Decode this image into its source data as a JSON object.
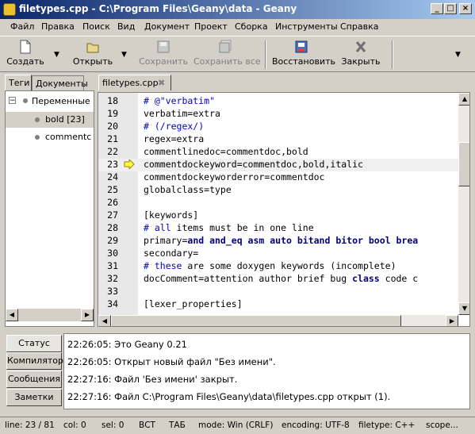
{
  "window": {
    "title": "filetypes.cpp - C:\\Program Files\\Geany\\data - Geany",
    "controls": [
      "_",
      "□",
      "×"
    ]
  },
  "menu": [
    "Файл",
    "Правка",
    "Поиск",
    "Вид",
    "Документ",
    "Проект",
    "Сборка",
    "Инструменты",
    "Справка"
  ],
  "toolbar": {
    "new": "Создать",
    "open": "Открыть",
    "save": "Сохранить",
    "save_all": "Сохранить все",
    "revert": "Восстановить",
    "close": "Закрыть"
  },
  "sidebar": {
    "tabs": [
      "Теги",
      "Документы"
    ],
    "tree": [
      {
        "label": "Переменные",
        "expander": "−"
      },
      {
        "label": "bold [23]"
      },
      {
        "label": "commentc"
      }
    ]
  },
  "editor": {
    "tab_label": "filetypes.cpp",
    "lines": [
      {
        "n": "18",
        "segments": [
          {
            "t": "# @\"verbatim\"",
            "c": "cm"
          }
        ]
      },
      {
        "n": "19",
        "segments": [
          {
            "t": "verbatim=extra",
            "c": ""
          }
        ]
      },
      {
        "n": "20",
        "segments": [
          {
            "t": "# (/regex/)",
            "c": "cm"
          }
        ]
      },
      {
        "n": "21",
        "segments": [
          {
            "t": "regex=extra",
            "c": ""
          }
        ]
      },
      {
        "n": "22",
        "segments": [
          {
            "t": "commentlinedoc=commentdoc,bold",
            "c": ""
          }
        ]
      },
      {
        "n": "23",
        "segments": [
          {
            "t": "commentdockeyword=commentdoc,bold,italic",
            "c": ""
          }
        ],
        "current": true
      },
      {
        "n": "24",
        "segments": [
          {
            "t": "commentdockeyworderror=commentdoc",
            "c": ""
          }
        ]
      },
      {
        "n": "25",
        "segments": [
          {
            "t": "globalclass=type",
            "c": ""
          }
        ]
      },
      {
        "n": "26",
        "segments": []
      },
      {
        "n": "27",
        "segments": [
          {
            "t": "[keywords]",
            "c": ""
          }
        ]
      },
      {
        "n": "28",
        "segments": [
          {
            "t": "# all",
            "c": "cm"
          },
          {
            "t": " items must be in one line",
            "c": ""
          }
        ]
      },
      {
        "n": "29",
        "segments": [
          {
            "t": "primary=",
            "c": ""
          },
          {
            "t": "and and_eq asm auto bitand bitor bool brea",
            "c": "kw"
          }
        ]
      },
      {
        "n": "30",
        "segments": [
          {
            "t": "secondary=",
            "c": ""
          }
        ]
      },
      {
        "n": "31",
        "segments": [
          {
            "t": "# these",
            "c": "cm"
          },
          {
            "t": " are some doxygen keywords (incomplete)",
            "c": ""
          }
        ]
      },
      {
        "n": "32",
        "segments": [
          {
            "t": "docComment=attention author brief bug ",
            "c": ""
          },
          {
            "t": "class",
            "c": "kw"
          },
          {
            "t": " code c",
            "c": ""
          }
        ]
      },
      {
        "n": "33",
        "segments": []
      },
      {
        "n": "34",
        "segments": [
          {
            "t": "[lexer_properties]",
            "c": ""
          }
        ]
      }
    ]
  },
  "messages": {
    "tabs": [
      "Статус",
      "Компилятор",
      "Сообщения",
      "Заметки"
    ],
    "lines": [
      "22:26:05: Это Geany 0.21",
      "22:26:05: Открыт новый файл \"Без имени\".",
      "22:27:16: Файл 'Без имени' закрыт.",
      "22:27:16: Файл C:\\Program Files\\Geany\\data\\filetypes.cpp открыт (1)."
    ]
  },
  "status": {
    "line": "line: 23 / 81",
    "col": "col: 0",
    "sel": "sel: 0",
    "ins": "ВСТ",
    "tab": "ТАБ",
    "mode": "mode: Win (CRLF)",
    "encoding": "encoding: UTF-8",
    "filetype": "filetype: C++",
    "scope": "scope..."
  }
}
